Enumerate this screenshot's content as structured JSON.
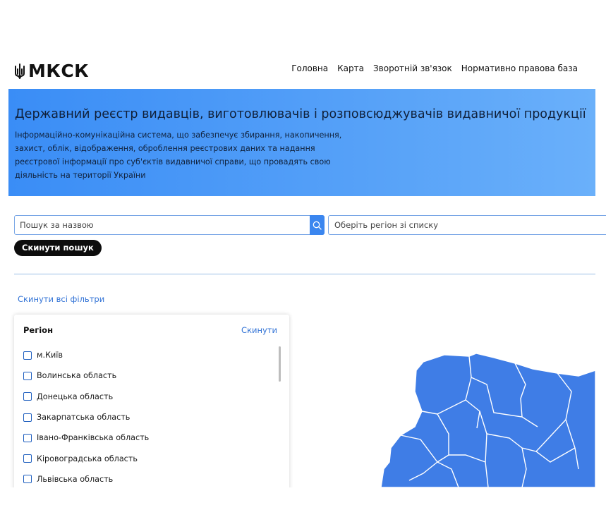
{
  "header": {
    "logo_text": "МКСК",
    "nav": [
      "Головна",
      "Карта",
      "Зворотній зв'язок",
      "Нормативно правова база"
    ]
  },
  "hero": {
    "title": "Державний реєстр видавців, виготовлювачів і розповсюджувачів видавничої продукції",
    "description": "Інформаційно-комунікаційна система, що забезпечує збирання, накопичення, захист, облік, відображення, оброблення реєстрових даних та надання реєстрової інформації про суб'єктів видавничої справи, що провадять свою діяльність на території України"
  },
  "search": {
    "placeholder": "Пошук за назвою",
    "value": "",
    "region_placeholder": "Оберіть регіон зі списку",
    "reset_label": "Скинути пошук"
  },
  "filters": {
    "reset_all_label": "Скинути всі фільтри",
    "panel_title": "Регіон",
    "panel_reset_label": "Скинути",
    "regions": [
      "м.Київ",
      "Волинська область",
      "Донецька область",
      "Закарпатська область",
      "Івано-Франківська область",
      "Кіровоградська область",
      "Львівська область"
    ]
  },
  "colors": {
    "hero_gradient_start": "#3a8df6",
    "hero_gradient_end": "#6ab0fa",
    "accent": "#3b86ef",
    "link": "#3273d6",
    "map_fill": "#3f7de6"
  },
  "icons": {
    "logo": "trident-icon",
    "search": "search-icon"
  }
}
